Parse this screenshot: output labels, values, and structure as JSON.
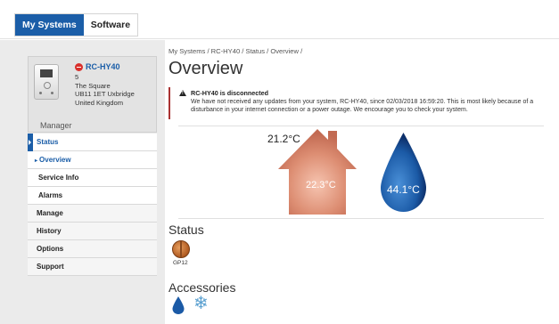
{
  "tabs": [
    {
      "label": "My Systems",
      "active": true
    },
    {
      "label": "Software",
      "active": false
    }
  ],
  "device": {
    "name": "RC-HY40",
    "address_lines": [
      "5",
      "The Square",
      "UB11 1ET Uxbridge",
      "United Kingdom"
    ],
    "role": "Manager",
    "status_icon": "stop-icon"
  },
  "nav": [
    {
      "label": "Status",
      "state": "active"
    },
    {
      "label": "Overview",
      "state": "sub-current"
    },
    {
      "label": "Service Info",
      "state": "sub"
    },
    {
      "label": "Alarms",
      "state": "sub"
    },
    {
      "label": "Manage",
      "state": "normal"
    },
    {
      "label": "History",
      "state": "normal"
    },
    {
      "label": "Options",
      "state": "normal"
    },
    {
      "label": "Support",
      "state": "normal"
    }
  ],
  "breadcrumb": "My Systems / RC-HY40 / Status / Overview /",
  "page_title": "Overview",
  "alert": {
    "title": "RC-HY40 is disconnected",
    "body": "We have not received any updates from your system, RC-HY40, since 02/03/2018 16:59:20. This is most likely because of a disturbance in your internet connection or a power outage. We encourage you to check your system."
  },
  "readings": {
    "outdoor_temp": "21.2°C",
    "indoor_temp": "22.3°C",
    "hot_water_temp": "44.1°C"
  },
  "status_section": {
    "title": "Status",
    "items": [
      {
        "label": "GP12",
        "icon": "pump-icon"
      }
    ]
  },
  "accessories_section": {
    "title": "Accessories",
    "icons": [
      "water-drop-icon",
      "snowflake-icon"
    ]
  },
  "colors": {
    "accent": "#1b5ea8",
    "house": "#d98a72",
    "drop": "#1a5fa8",
    "alert_border": "#aa3333"
  }
}
